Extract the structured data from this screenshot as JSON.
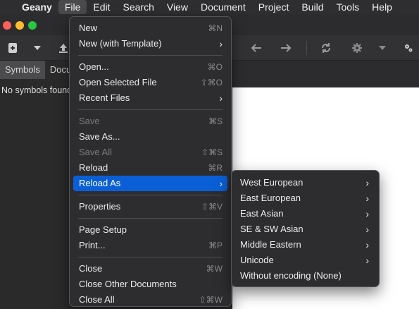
{
  "menubar": {
    "apple_glyph": "",
    "app_name": "Geany",
    "items": [
      "File",
      "Edit",
      "Search",
      "View",
      "Document",
      "Project",
      "Build",
      "Tools",
      "Help"
    ]
  },
  "tabs": [
    "Symbols",
    "Docu"
  ],
  "sidebar": {
    "empty_text": "No symbols found"
  },
  "file_menu": {
    "new": {
      "label": "New",
      "shortcut": "⌘N"
    },
    "new_template": {
      "label": "New (with Template)",
      "arrow": "›"
    },
    "open": {
      "label": "Open...",
      "shortcut": "⌘O"
    },
    "open_selected": {
      "label": "Open Selected File",
      "shortcut": "⇧⌘O"
    },
    "recent": {
      "label": "Recent Files",
      "arrow": "›"
    },
    "save": {
      "label": "Save",
      "shortcut": "⌘S"
    },
    "save_as": {
      "label": "Save As..."
    },
    "save_all": {
      "label": "Save All",
      "shortcut": "⇧⌘S"
    },
    "reload": {
      "label": "Reload",
      "shortcut": "⌘R"
    },
    "reload_as": {
      "label": "Reload As",
      "arrow": "›"
    },
    "properties": {
      "label": "Properties",
      "shortcut": "⇧⌘V"
    },
    "page_setup": {
      "label": "Page Setup"
    },
    "print": {
      "label": "Print...",
      "shortcut": "⌘P"
    },
    "close": {
      "label": "Close",
      "shortcut": "⌘W"
    },
    "close_other": {
      "label": "Close Other Documents"
    },
    "close_all": {
      "label": "Close All",
      "shortcut": "⇧⌘W"
    }
  },
  "reload_as_menu": {
    "west_european": "West European",
    "east_european": "East European",
    "east_asian": "East Asian",
    "se_sw_asian": "SE & SW Asian",
    "middle_eastern": "Middle Eastern",
    "unicode": "Unicode",
    "without_encoding": "Without encoding (None)",
    "arrow": "›"
  },
  "colors": {
    "highlight": "#0a5fd6",
    "menu_bg": "#2d2d30"
  }
}
